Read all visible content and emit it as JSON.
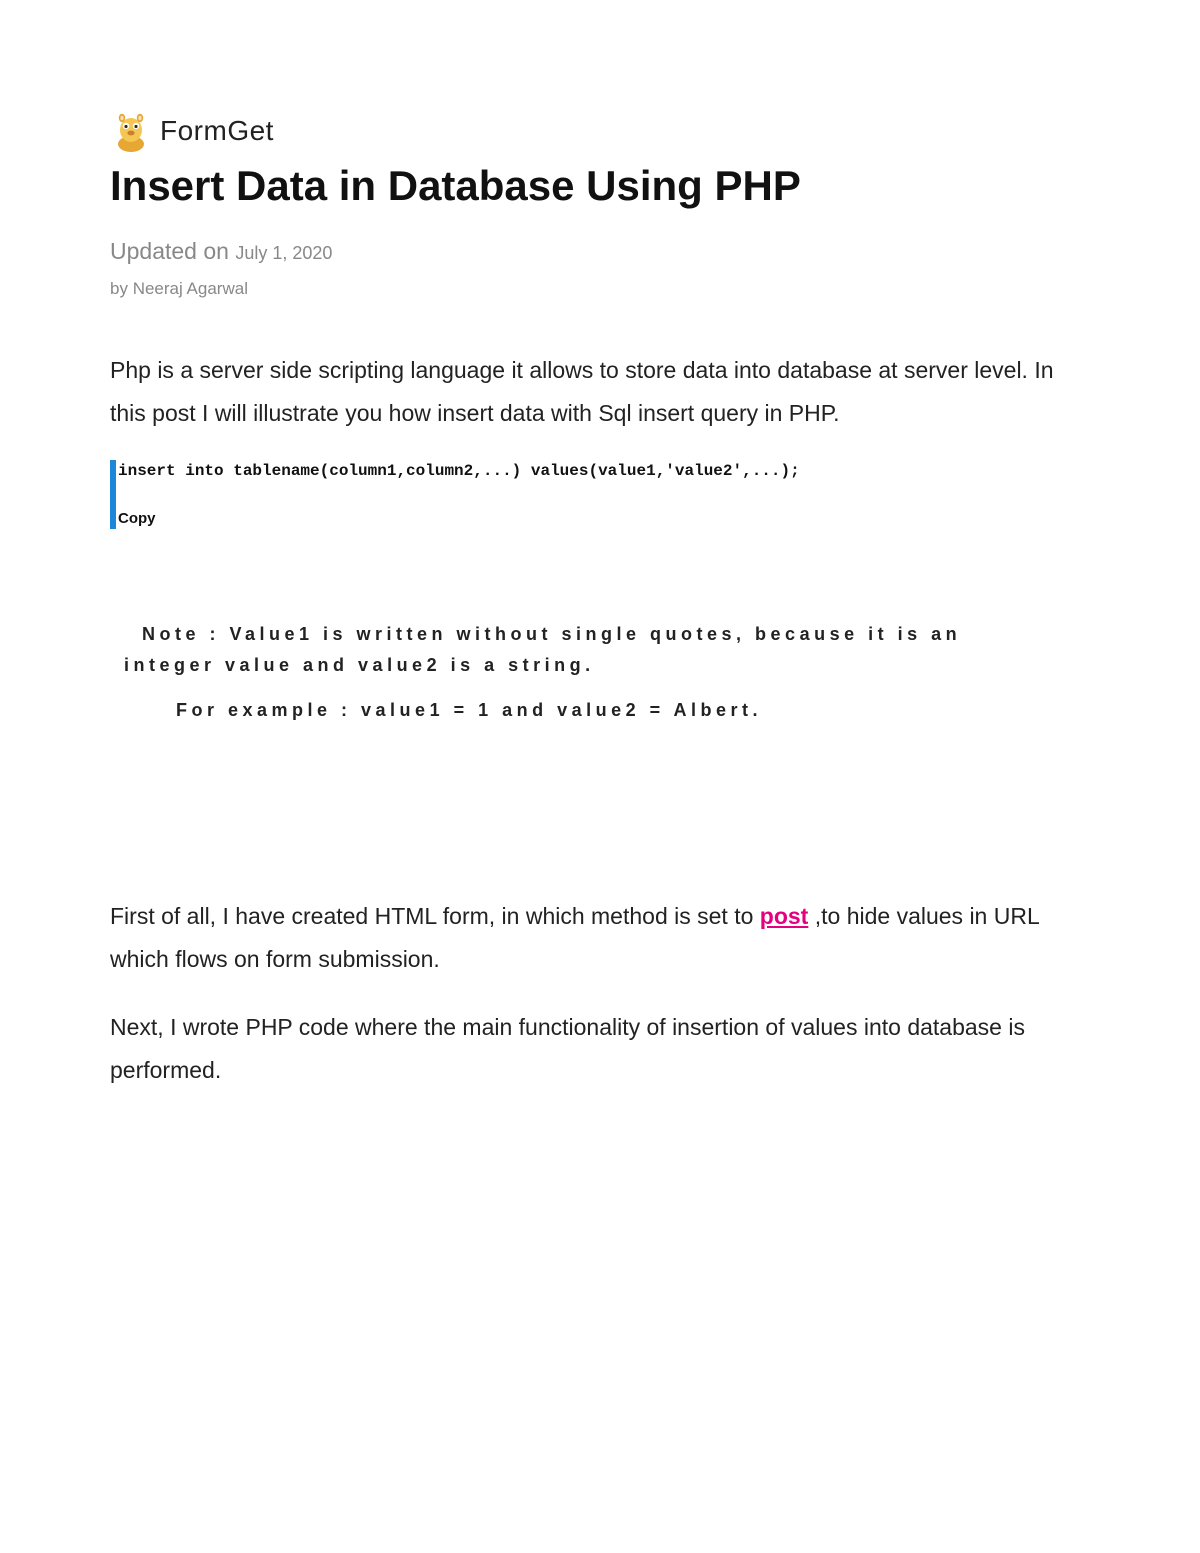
{
  "logo": {
    "text": "FormGet"
  },
  "article": {
    "title": "Insert Data in Database Using PHP",
    "updated_prefix": "Updated on ",
    "updated_date": "July 1, 2020",
    "author_prefix": "by ",
    "author_name": "Neeraj Agarwal"
  },
  "paragraphs": {
    "intro": "Php is a server side scripting language it allows to store data into database at server level. In this post I will illustrate you how insert data with Sql insert query in PHP.",
    "p2_before": "First of all, I have created  HTML form, in which method is set to ",
    "p2_link": "post",
    "p2_after": " ,to hide values in URL which flows on form submission.",
    "p3": "Next, I wrote PHP code where the main functionality of insertion of values into database is performed."
  },
  "code": {
    "line": "insert into tablename(column1,column2,...) values(value1,'value2',...);",
    "copy_label": "Copy"
  },
  "note": {
    "line1": "Note : Value1 is written without single quotes, because it is an",
    "line2": "integer value and value2 is a string.",
    "example": "For example : value1 = 1 and value2 = Albert."
  }
}
